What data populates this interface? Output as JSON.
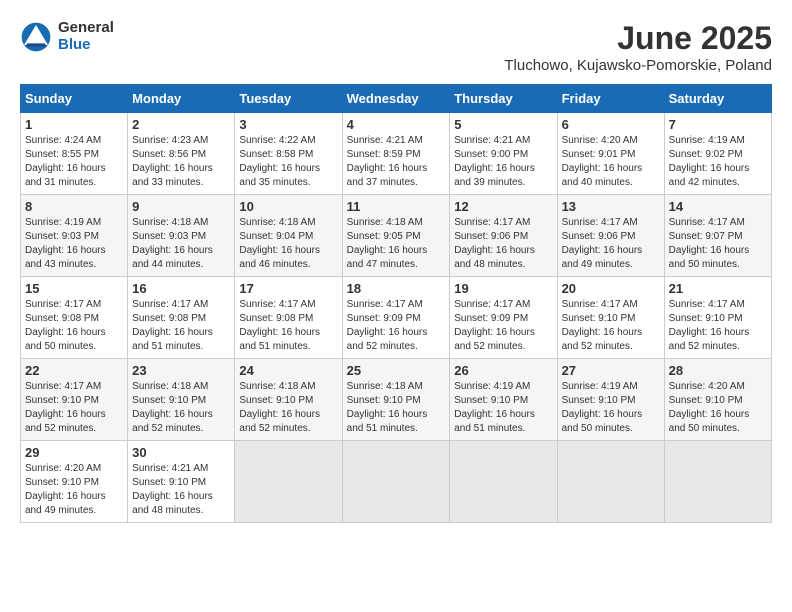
{
  "logo": {
    "general": "General",
    "blue": "Blue"
  },
  "title": {
    "month": "June 2025",
    "location": "Tluchowo, Kujawsko-Pomorskie, Poland"
  },
  "weekdays": [
    "Sunday",
    "Monday",
    "Tuesday",
    "Wednesday",
    "Thursday",
    "Friday",
    "Saturday"
  ],
  "weeks": [
    [
      {
        "day": "1",
        "sunrise": "4:24 AM",
        "sunset": "8:55 PM",
        "daylight": "16 hours and 31 minutes."
      },
      {
        "day": "2",
        "sunrise": "4:23 AM",
        "sunset": "8:56 PM",
        "daylight": "16 hours and 33 minutes."
      },
      {
        "day": "3",
        "sunrise": "4:22 AM",
        "sunset": "8:58 PM",
        "daylight": "16 hours and 35 minutes."
      },
      {
        "day": "4",
        "sunrise": "4:21 AM",
        "sunset": "8:59 PM",
        "daylight": "16 hours and 37 minutes."
      },
      {
        "day": "5",
        "sunrise": "4:21 AM",
        "sunset": "9:00 PM",
        "daylight": "16 hours and 39 minutes."
      },
      {
        "day": "6",
        "sunrise": "4:20 AM",
        "sunset": "9:01 PM",
        "daylight": "16 hours and 40 minutes."
      },
      {
        "day": "7",
        "sunrise": "4:19 AM",
        "sunset": "9:02 PM",
        "daylight": "16 hours and 42 minutes."
      }
    ],
    [
      {
        "day": "8",
        "sunrise": "4:19 AM",
        "sunset": "9:03 PM",
        "daylight": "16 hours and 43 minutes."
      },
      {
        "day": "9",
        "sunrise": "4:18 AM",
        "sunset": "9:03 PM",
        "daylight": "16 hours and 44 minutes."
      },
      {
        "day": "10",
        "sunrise": "4:18 AM",
        "sunset": "9:04 PM",
        "daylight": "16 hours and 46 minutes."
      },
      {
        "day": "11",
        "sunrise": "4:18 AM",
        "sunset": "9:05 PM",
        "daylight": "16 hours and 47 minutes."
      },
      {
        "day": "12",
        "sunrise": "4:17 AM",
        "sunset": "9:06 PM",
        "daylight": "16 hours and 48 minutes."
      },
      {
        "day": "13",
        "sunrise": "4:17 AM",
        "sunset": "9:06 PM",
        "daylight": "16 hours and 49 minutes."
      },
      {
        "day": "14",
        "sunrise": "4:17 AM",
        "sunset": "9:07 PM",
        "daylight": "16 hours and 50 minutes."
      }
    ],
    [
      {
        "day": "15",
        "sunrise": "4:17 AM",
        "sunset": "9:08 PM",
        "daylight": "16 hours and 50 minutes."
      },
      {
        "day": "16",
        "sunrise": "4:17 AM",
        "sunset": "9:08 PM",
        "daylight": "16 hours and 51 minutes."
      },
      {
        "day": "17",
        "sunrise": "4:17 AM",
        "sunset": "9:08 PM",
        "daylight": "16 hours and 51 minutes."
      },
      {
        "day": "18",
        "sunrise": "4:17 AM",
        "sunset": "9:09 PM",
        "daylight": "16 hours and 52 minutes."
      },
      {
        "day": "19",
        "sunrise": "4:17 AM",
        "sunset": "9:09 PM",
        "daylight": "16 hours and 52 minutes."
      },
      {
        "day": "20",
        "sunrise": "4:17 AM",
        "sunset": "9:10 PM",
        "daylight": "16 hours and 52 minutes."
      },
      {
        "day": "21",
        "sunrise": "4:17 AM",
        "sunset": "9:10 PM",
        "daylight": "16 hours and 52 minutes."
      }
    ],
    [
      {
        "day": "22",
        "sunrise": "4:17 AM",
        "sunset": "9:10 PM",
        "daylight": "16 hours and 52 minutes."
      },
      {
        "day": "23",
        "sunrise": "4:18 AM",
        "sunset": "9:10 PM",
        "daylight": "16 hours and 52 minutes."
      },
      {
        "day": "24",
        "sunrise": "4:18 AM",
        "sunset": "9:10 PM",
        "daylight": "16 hours and 52 minutes."
      },
      {
        "day": "25",
        "sunrise": "4:18 AM",
        "sunset": "9:10 PM",
        "daylight": "16 hours and 51 minutes."
      },
      {
        "day": "26",
        "sunrise": "4:19 AM",
        "sunset": "9:10 PM",
        "daylight": "16 hours and 51 minutes."
      },
      {
        "day": "27",
        "sunrise": "4:19 AM",
        "sunset": "9:10 PM",
        "daylight": "16 hours and 50 minutes."
      },
      {
        "day": "28",
        "sunrise": "4:20 AM",
        "sunset": "9:10 PM",
        "daylight": "16 hours and 50 minutes."
      }
    ],
    [
      {
        "day": "29",
        "sunrise": "4:20 AM",
        "sunset": "9:10 PM",
        "daylight": "16 hours and 49 minutes."
      },
      {
        "day": "30",
        "sunrise": "4:21 AM",
        "sunset": "9:10 PM",
        "daylight": "16 hours and 48 minutes."
      },
      null,
      null,
      null,
      null,
      null
    ]
  ]
}
